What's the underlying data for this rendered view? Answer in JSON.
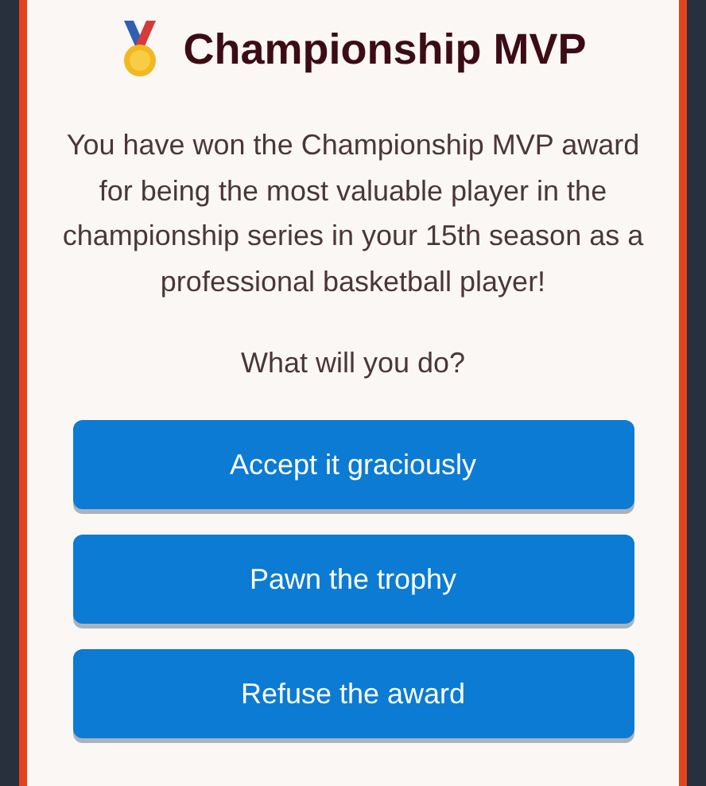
{
  "dialog": {
    "title": "Championship MVP",
    "message": "You have won the Championship MVP award for being the most valuable player in the championship series in your 15th season as a professional basketball player!",
    "prompt": "What will you do?",
    "choices": [
      "Accept it graciously",
      "Pawn the trophy",
      "Refuse the award"
    ]
  }
}
